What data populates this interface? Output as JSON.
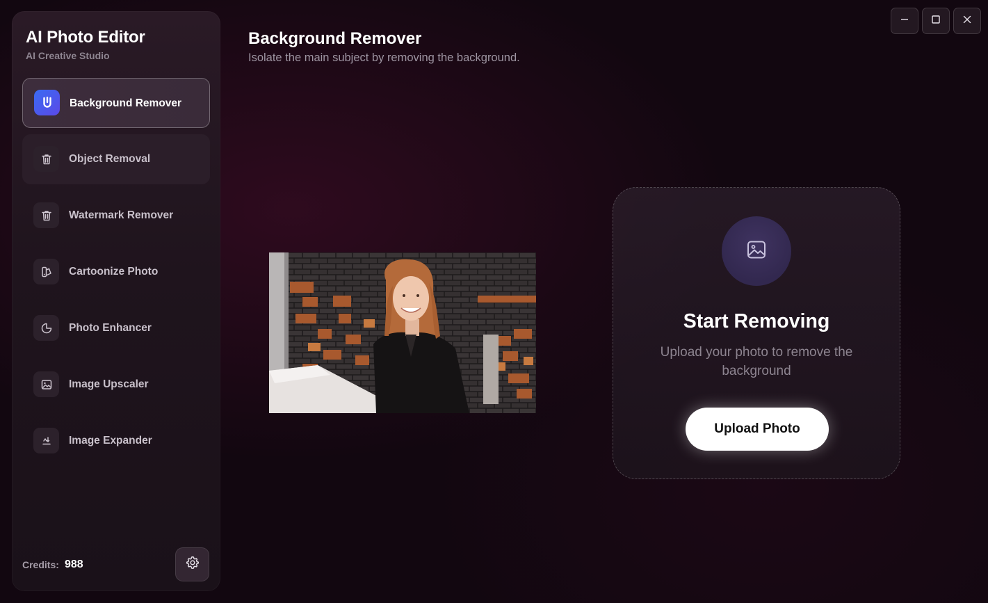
{
  "app": {
    "title": "AI Photo Editor",
    "subtitle": "AI Creative Studio"
  },
  "sidebar": {
    "items": [
      {
        "label": "Background Remover",
        "icon": "upload-icon",
        "state": "active"
      },
      {
        "label": "Object Removal",
        "icon": "trash-icon",
        "state": "hover"
      },
      {
        "label": "Watermark Remover",
        "icon": "trash-icon",
        "state": "normal"
      },
      {
        "label": "Cartoonize Photo",
        "icon": "palette-icon",
        "state": "normal"
      },
      {
        "label": "Photo Enhancer",
        "icon": "moon-icon",
        "state": "normal"
      },
      {
        "label": "Image Upscaler",
        "icon": "image-icon",
        "state": "normal"
      },
      {
        "label": "Image Expander",
        "icon": "expand-icon",
        "state": "normal"
      }
    ],
    "credits_label": "Credits:",
    "credits_value": "988",
    "settings_icon": "gear-icon"
  },
  "header": {
    "title": "Background Remover",
    "subtitle": "Isolate the main subject by removing the background."
  },
  "window_controls": {
    "minimize_icon": "minimize-icon",
    "maximize_icon": "maximize-icon",
    "close_icon": "close-icon"
  },
  "preview": {
    "icon": "sample-photo"
  },
  "upload": {
    "icon": "image-icon",
    "title": "Start Removing",
    "description": "Upload your photo to remove the background",
    "button_label": "Upload Photo"
  },
  "colors": {
    "background": "#120710",
    "sidebar": "#221620",
    "accent_blue": "#3a6bf2",
    "accent_purple": "#5b49e8",
    "upload_button": "#ffffff"
  }
}
